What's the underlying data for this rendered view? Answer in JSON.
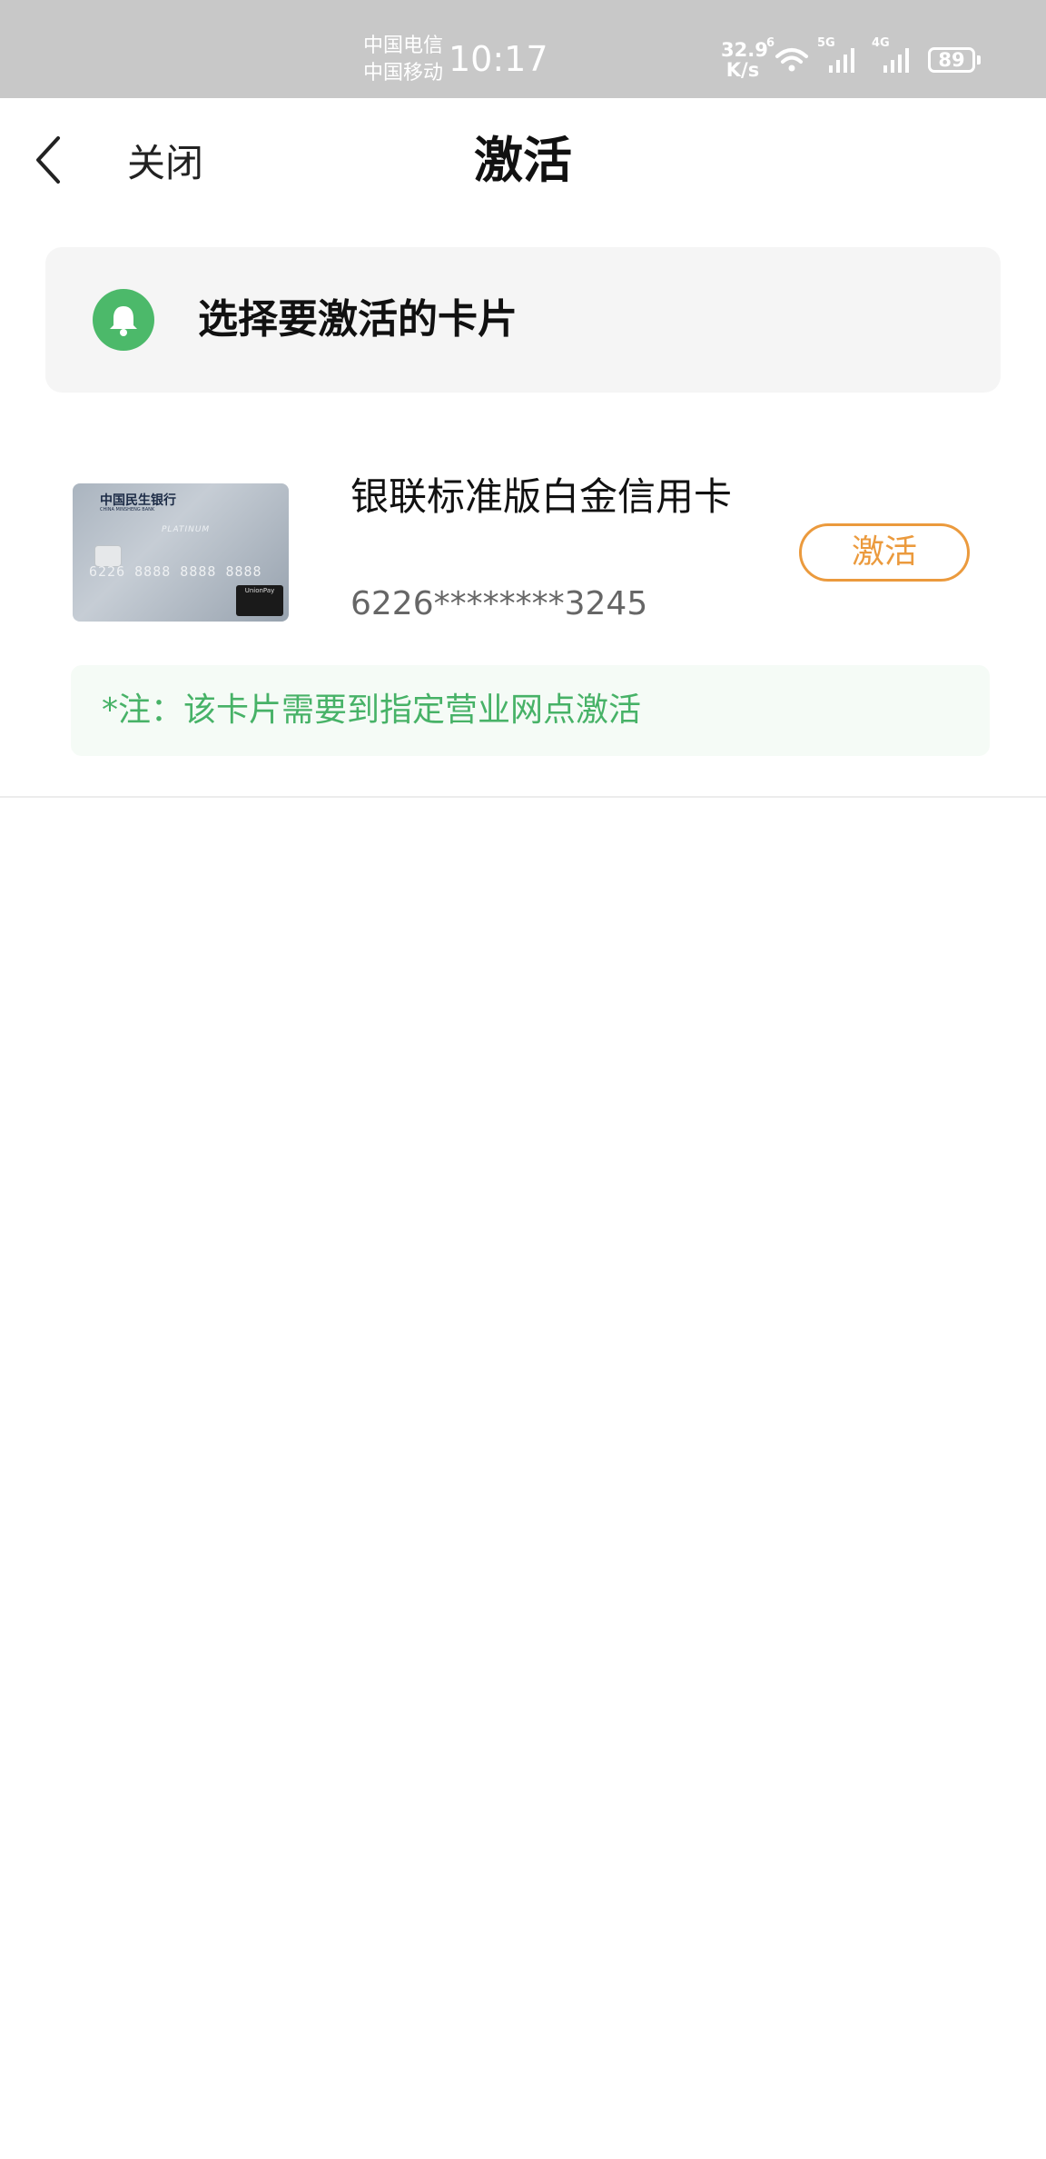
{
  "status_bar": {
    "carrier_1": "中国电信",
    "carrier_2": "中国移动",
    "time": "10:17",
    "net_speed_value": "32.9",
    "net_speed_unit": "K/s",
    "wifi_badge": "6",
    "signal_1_type": "5G",
    "signal_2_type": "4G",
    "battery_level": "89",
    "icons": [
      "wifi-icon",
      "signal-icon",
      "signal-icon",
      "battery-icon"
    ]
  },
  "nav": {
    "back_icon": "chevron-left-icon",
    "close_label": "关闭",
    "title": "激活"
  },
  "banner": {
    "icon": "bell-icon",
    "text": "选择要激活的卡片",
    "icon_color": "#4cb96a"
  },
  "card": {
    "title": "银联标准版白金信用卡",
    "number": "6226********3245",
    "activate_label": "激活",
    "activate_color": "#eb9a3d",
    "image": {
      "bank_name": "中国民生银行",
      "bank_name_en": "CHINA MINSHENG BANK",
      "tier": "PLATINUM",
      "sample_number": "6226 8888 8888 8888",
      "brand": "UnionPay"
    },
    "note": "*注：该卡片需要到指定营业网点激活",
    "note_color": "#47b267"
  }
}
